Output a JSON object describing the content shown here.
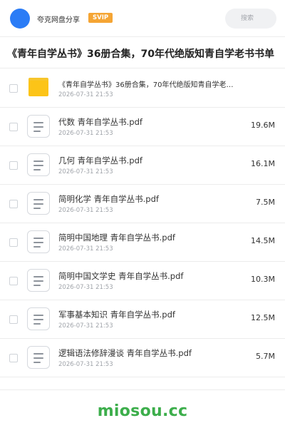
{
  "header": {
    "brand": "夸克网盘分享",
    "badge": "SVIP",
    "search_placeholder": "搜索",
    "avatar_color": "#2b7cf6",
    "badge_color": "#f5a534"
  },
  "share_title": "《青年自学丛书》36册合集，70年代绝版知青自学老书书单",
  "items": [
    {
      "type": "folder",
      "icon": "folder-icon",
      "name": "《青年自学丛书》36册合集，70年代绝版知青自学老…",
      "date": "2026-07-31 21:53",
      "size": ""
    },
    {
      "type": "file",
      "icon": "document-icon",
      "name": "代数 青年自学丛书.pdf",
      "date": "2026-07-31 21:53",
      "size": "19.6M"
    },
    {
      "type": "file",
      "icon": "document-icon",
      "name": "几何 青年自学丛书.pdf",
      "date": "2026-07-31 21:53",
      "size": "16.1M"
    },
    {
      "type": "file",
      "icon": "document-icon",
      "name": "简明化学 青年自学丛书.pdf",
      "date": "2026-07-31 21:53",
      "size": "7.5M"
    },
    {
      "type": "file",
      "icon": "document-icon",
      "name": "简明中国地理 青年自学丛书.pdf",
      "date": "2026-07-31 21:53",
      "size": "14.5M"
    },
    {
      "type": "file",
      "icon": "document-icon",
      "name": "简明中国文学史 青年自学丛书.pdf",
      "date": "2026-07-31 21:53",
      "size": "10.3M"
    },
    {
      "type": "file",
      "icon": "document-icon",
      "name": "军事基本知识 青年自学丛书.pdf",
      "date": "2026-07-31 21:53",
      "size": "12.5M"
    },
    {
      "type": "file",
      "icon": "document-icon",
      "name": "逻辑语法修辞漫谈 青年自学丛书.pdf",
      "date": "2026-07-31 21:53",
      "size": "5.7M"
    }
  ],
  "footer": {
    "brand": "miosou.cc",
    "brand_color": "#3cae4b"
  }
}
